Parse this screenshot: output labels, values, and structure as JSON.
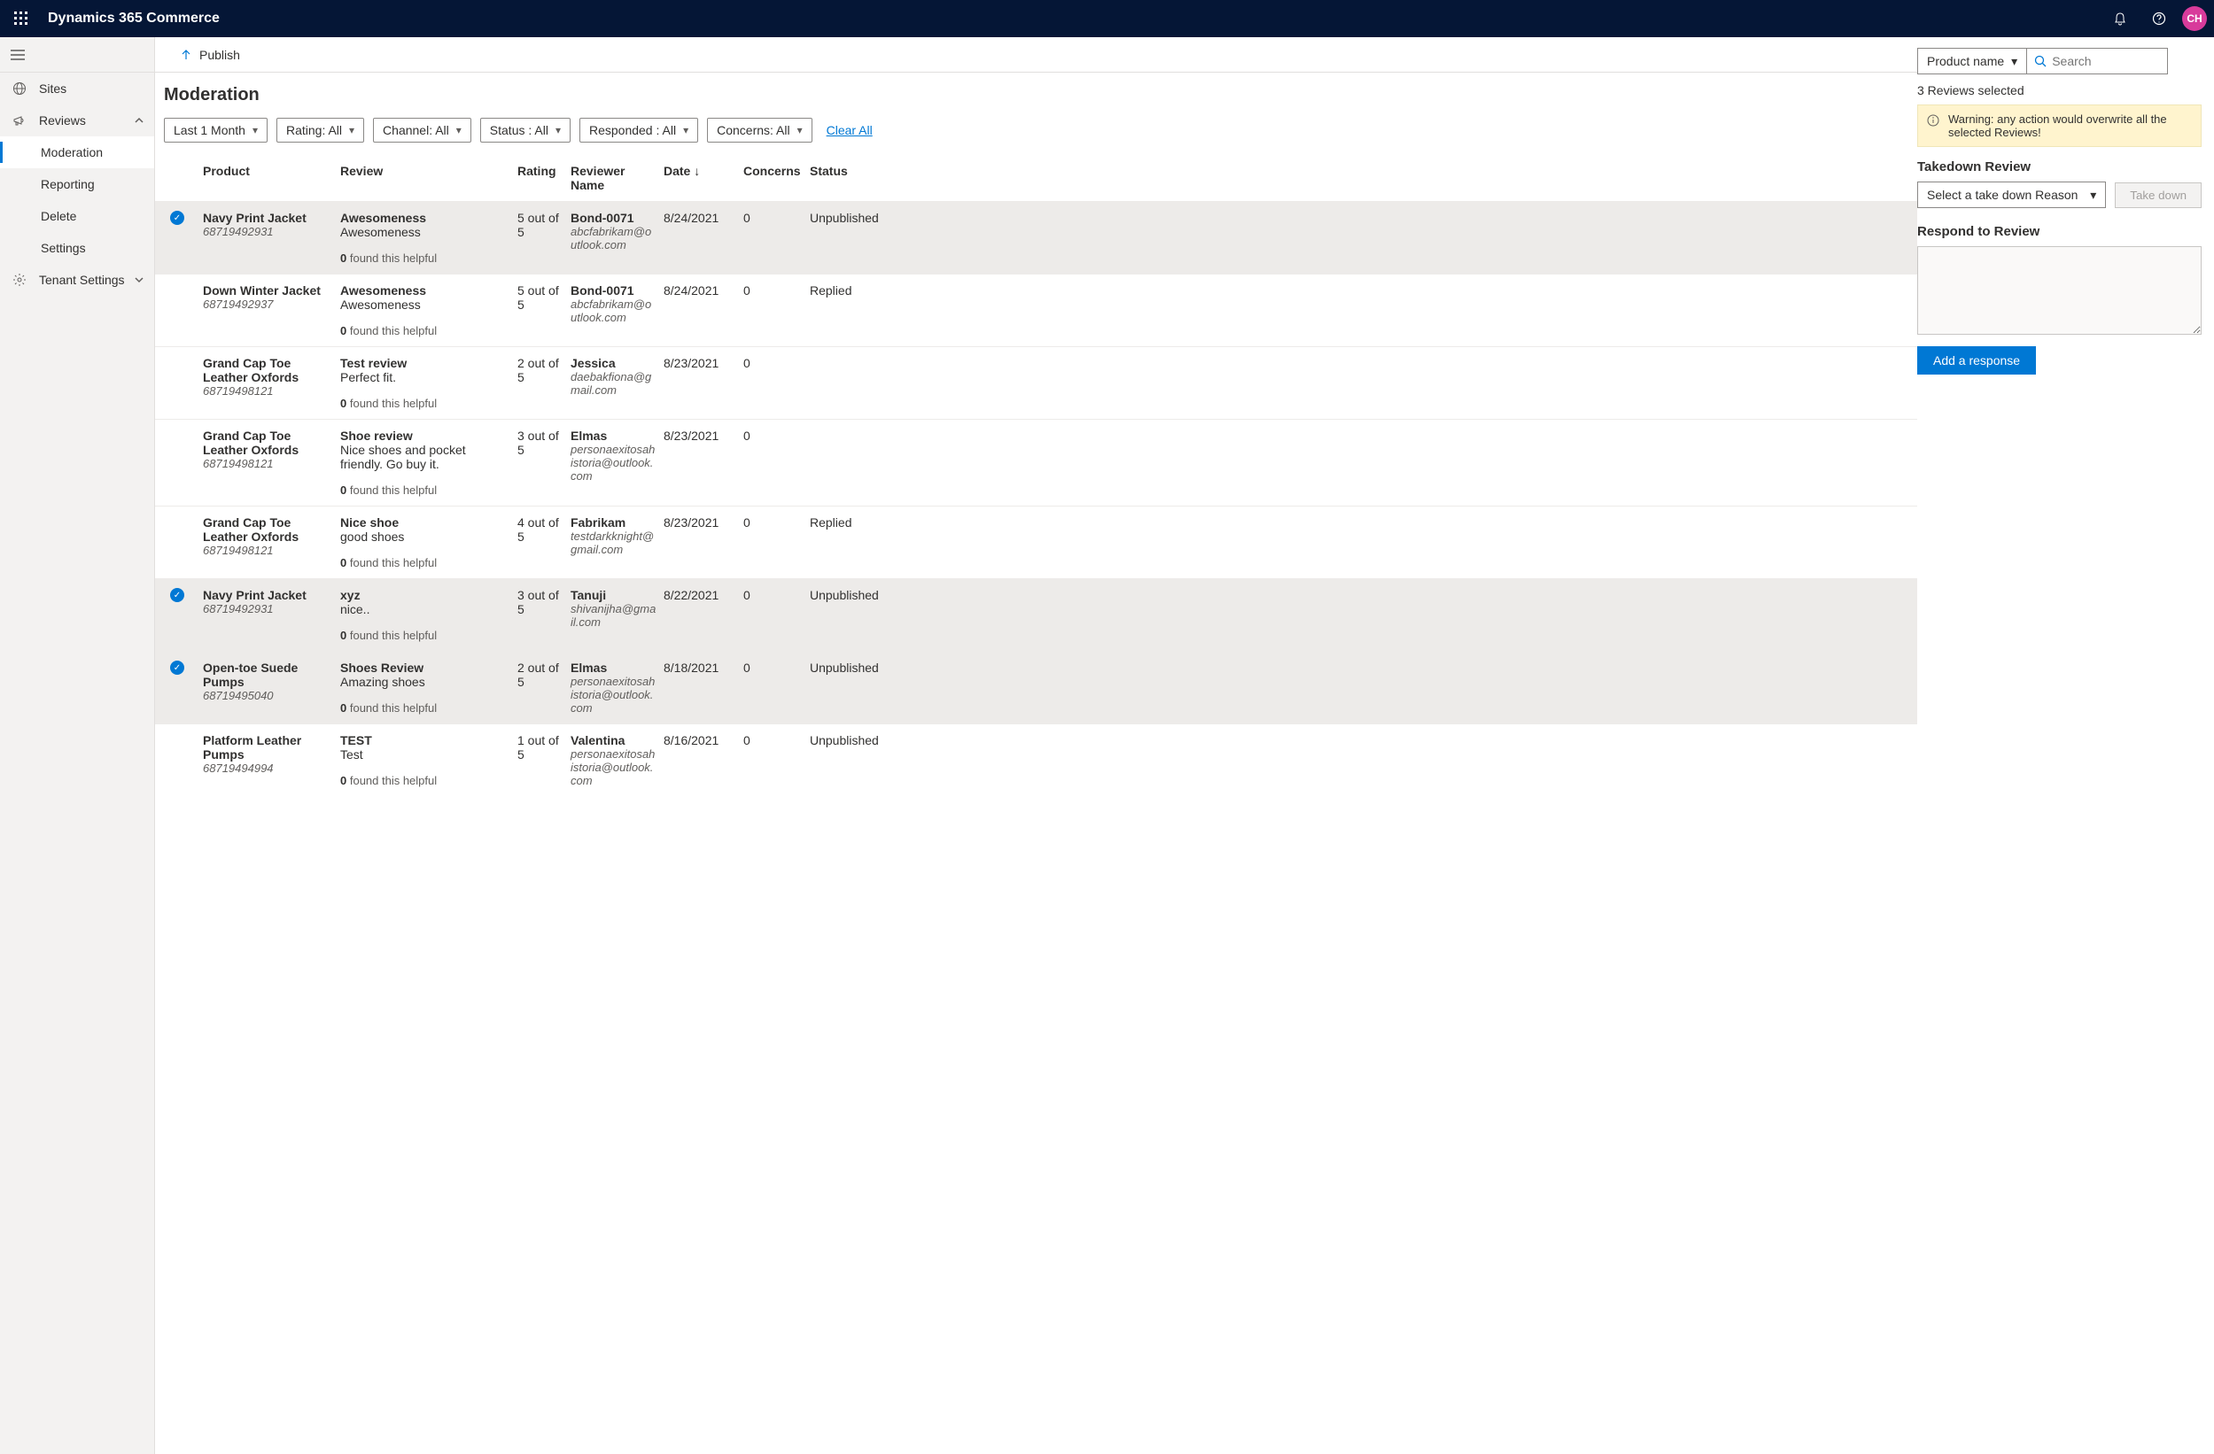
{
  "header": {
    "app_title": "Dynamics 365 Commerce",
    "avatar_initials": "CH"
  },
  "sidebar": {
    "sites": "Sites",
    "reviews": "Reviews",
    "moderation": "Moderation",
    "reporting": "Reporting",
    "delete": "Delete",
    "settings": "Settings",
    "tenant_settings": "Tenant Settings"
  },
  "publish": {
    "label": "Publish"
  },
  "page": {
    "title": "Moderation"
  },
  "search": {
    "product_label": "Product name",
    "placeholder": "Search"
  },
  "filters": {
    "f0": "Last 1 Month",
    "f1": "Rating: All",
    "f2": "Channel: All",
    "f3": "Status : All",
    "f4": "Responded : All",
    "f5": "Concerns: All",
    "clear": "Clear All"
  },
  "columns": {
    "product": "Product",
    "review": "Review",
    "rating": "Rating",
    "reviewer": "Reviewer Name",
    "date": "Date",
    "concerns": "Concerns",
    "status": "Status"
  },
  "rows": [
    {
      "selected": true,
      "product": "Navy Print Jacket",
      "sku": "68719492931",
      "title": "Awesomeness",
      "body": "Awesomeness",
      "helpful": "0",
      "helpful_suffix": " found this helpful",
      "rating": "5 out of 5",
      "reviewer": "Bond-0071",
      "email": "abcfabrikam@outlook.com",
      "date": "8/24/2021",
      "concerns": "0",
      "status": "Unpublished"
    },
    {
      "selected": false,
      "product": "Down Winter Jacket",
      "sku": "68719492937",
      "title": "Awesomeness",
      "body": "Awesomeness",
      "helpful": "0",
      "helpful_suffix": " found this helpful",
      "rating": "5 out of 5",
      "reviewer": "Bond-0071",
      "email": "abcfabrikam@outlook.com",
      "date": "8/24/2021",
      "concerns": "0",
      "status": "Replied"
    },
    {
      "selected": false,
      "product": "Grand Cap Toe Leather Oxfords",
      "sku": "68719498121",
      "title": "Test review",
      "body": "Perfect fit.",
      "helpful": "0",
      "helpful_suffix": " found this helpful",
      "rating": "2 out of 5",
      "reviewer": "Jessica",
      "email": "daebakfiona@gmail.com",
      "date": "8/23/2021",
      "concerns": "0",
      "status": ""
    },
    {
      "selected": false,
      "product": "Grand Cap Toe Leather Oxfords",
      "sku": "68719498121",
      "title": "Shoe review",
      "body": "Nice shoes and pocket friendly. Go buy it.",
      "helpful": "0",
      "helpful_suffix": " found this helpful",
      "rating": "3 out of 5",
      "reviewer": "Elmas",
      "email": "personaexitosahistoria@outlook.com",
      "date": "8/23/2021",
      "concerns": "0",
      "status": ""
    },
    {
      "selected": false,
      "product": "Grand Cap Toe Leather Oxfords",
      "sku": "68719498121",
      "title": "Nice shoe",
      "body": "good shoes",
      "helpful": "0",
      "helpful_suffix": " found this helpful",
      "rating": "4 out of 5",
      "reviewer": "Fabrikam",
      "email": "testdarkknight@gmail.com",
      "date": "8/23/2021",
      "concerns": "0",
      "status": "Replied"
    },
    {
      "selected": true,
      "product": "Navy Print Jacket",
      "sku": "68719492931",
      "title": "xyz",
      "body": "nice..",
      "helpful": "0",
      "helpful_suffix": " found this helpful",
      "rating": "3 out of 5",
      "reviewer": "Tanuji",
      "email": "shivanijha@gmail.com",
      "date": "8/22/2021",
      "concerns": "0",
      "status": "Unpublished"
    },
    {
      "selected": true,
      "product": "Open-toe Suede Pumps",
      "sku": "68719495040",
      "title": "Shoes Review",
      "body": "Amazing shoes",
      "helpful": "0",
      "helpful_suffix": " found this helpful",
      "rating": "2 out of 5",
      "reviewer": "Elmas",
      "email": "personaexitosahistoria@outlook.com",
      "date": "8/18/2021",
      "concerns": "0",
      "status": "Unpublished"
    },
    {
      "selected": false,
      "product": "Platform Leather Pumps",
      "sku": "68719494994",
      "title": "TEST",
      "body": "Test",
      "helpful": "0",
      "helpful_suffix": " found this helpful",
      "rating": "1 out of 5",
      "reviewer": "Valentina",
      "email": "personaexitosahistoria@outlook.com",
      "date": "8/16/2021",
      "concerns": "0",
      "status": "Unpublished"
    }
  ],
  "right": {
    "selected_text": "3 Reviews selected",
    "warning": "Warning: any action would overwrite all the selected Reviews!",
    "takedown_title": "Takedown Review",
    "takedown_placeholder": "Select a take down Reason",
    "takedown_btn": "Take down",
    "respond_title": "Respond to Review",
    "add_response": "Add a response"
  }
}
